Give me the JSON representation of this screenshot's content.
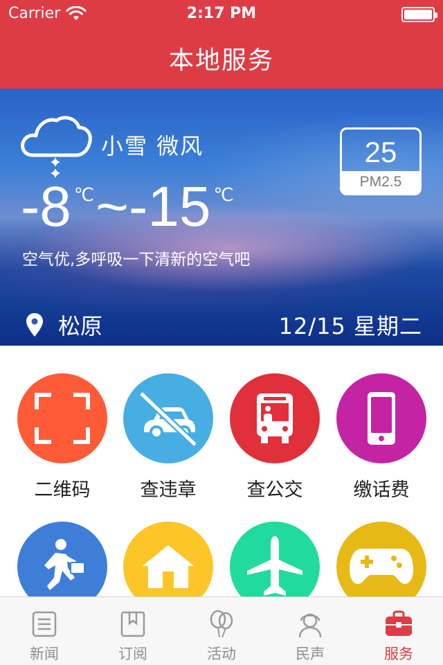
{
  "status_bar": {
    "carrier": "Carrier",
    "time": "2:17 PM"
  },
  "nav": {
    "title": "本地服务"
  },
  "weather": {
    "condition": "小雪 微风",
    "temp_high": "-8",
    "temp_sep": "~",
    "temp_low": "-15",
    "unit": "℃",
    "tip": "空气优,多呼吸一下清新的空气吧",
    "pm_value": "25",
    "pm_label": "PM2.5",
    "city": "松原",
    "date": "12/15 星期二"
  },
  "services": [
    {
      "label": "二维码",
      "icon": "qr-scan-icon",
      "color": "#ff5b37"
    },
    {
      "label": "查违章",
      "icon": "no-car-icon",
      "color": "#46aee3"
    },
    {
      "label": "查公交",
      "icon": "bus-icon",
      "color": "#e0303a"
    },
    {
      "label": "缴话费",
      "icon": "phone-icon",
      "color": "#c424a4"
    },
    {
      "label": "",
      "icon": "running-man-icon",
      "color": "#3f7ed8"
    },
    {
      "label": "",
      "icon": "house-icon",
      "color": "#fcc629"
    },
    {
      "label": "",
      "icon": "airplane-icon",
      "color": "#21db9e"
    },
    {
      "label": "",
      "icon": "gamepad-icon",
      "color": "#e7b915"
    }
  ],
  "tabs": [
    {
      "label": "新闻",
      "icon": "news-icon",
      "active": false
    },
    {
      "label": "订阅",
      "icon": "bookmark-icon",
      "active": false
    },
    {
      "label": "活动",
      "icon": "balloons-icon",
      "active": false
    },
    {
      "label": "民声",
      "icon": "headset-user-icon",
      "active": false
    },
    {
      "label": "服务",
      "icon": "toolbox-icon",
      "active": true
    }
  ],
  "colors": {
    "header": "#de3c45",
    "active_tab": "#de3c45",
    "inactive_tab": "#8e8e8e"
  }
}
